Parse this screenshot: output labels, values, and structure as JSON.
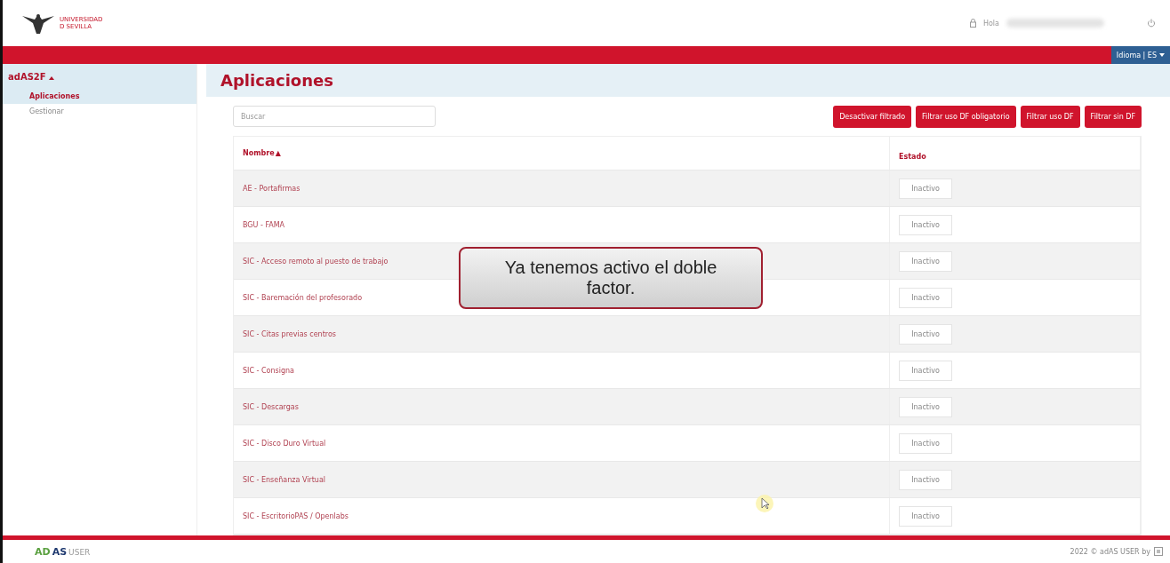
{
  "header": {
    "logo_lines": [
      "UNIVERSIDAD",
      "D SEVILLA"
    ],
    "greeting": "Hola",
    "language": "Idioma | ES"
  },
  "sidebar": {
    "title": "adAS2F",
    "expanded": true,
    "items": [
      {
        "label": "Aplicaciones",
        "selected": true
      },
      {
        "label": "Gestionar",
        "selected": false
      }
    ]
  },
  "page_title": "Aplicaciones",
  "search": {
    "placeholder": "Buscar"
  },
  "filter_buttons": [
    "Desactivar filtrado",
    "Filtrar uso DF obligatorio",
    "Filtrar uso DF",
    "Filtrar sin DF"
  ],
  "table": {
    "columns": [
      {
        "label": "Nombre",
        "sort": "▲"
      },
      {
        "label": "Estado"
      }
    ],
    "rows": [
      {
        "name": "AE - Portafirmas",
        "status": "Inactivo"
      },
      {
        "name": "BGU - FAMA",
        "status": "Inactivo"
      },
      {
        "name": "SIC - Acceso remoto al puesto de trabajo",
        "status": "Inactivo"
      },
      {
        "name": "SIC - Baremación del profesorado",
        "status": "Inactivo"
      },
      {
        "name": "SIC - Citas previas centros",
        "status": "Inactivo"
      },
      {
        "name": "SIC - Consigna",
        "status": "Inactivo"
      },
      {
        "name": "SIC - Descargas",
        "status": "Inactivo"
      },
      {
        "name": "SIC - Disco Duro Virtual",
        "status": "Inactivo"
      },
      {
        "name": "SIC - Enseñanza Virtual",
        "status": "Inactivo"
      },
      {
        "name": "SIC - EscritorioPAS / Openlabs",
        "status": "Inactivo"
      }
    ]
  },
  "callout": "Ya tenemos activo el doble factor.",
  "footer": {
    "brand": [
      "AD",
      "AS",
      "USER"
    ],
    "copyright": "2022 © adAS USER by"
  }
}
